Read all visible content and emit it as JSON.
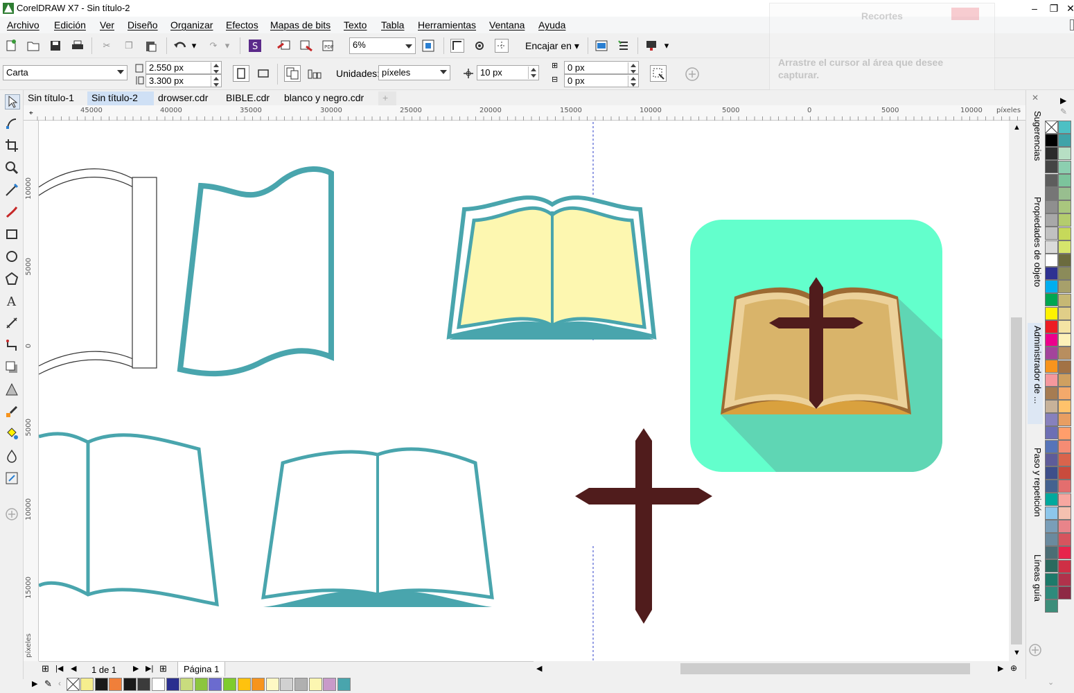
{
  "window": {
    "title": "CorelDRAW X7 - Sin título-2"
  },
  "menu": [
    "Archivo",
    "Edición",
    "Ver",
    "Diseño",
    "Organizar",
    "Efectos",
    "Mapas de bits",
    "Texto",
    "Tabla",
    "Herramientas",
    "Ventana",
    "Ayuda"
  ],
  "toolbar": {
    "zoom": "6%",
    "snap": "Encajar en"
  },
  "propertybar": {
    "paper": "Carta",
    "width": "2.550 px",
    "height": "3.300 px",
    "units_label": "Unidades:",
    "units": "píxeles",
    "nudge": "10 px",
    "dup_x": "0 px",
    "dup_y": "0 px"
  },
  "tabs": [
    "Sin título-1",
    "Sin título-2",
    "drowser.cdr",
    "BIBLE.cdr",
    "blanco y negro.cdr"
  ],
  "active_tab": "Sin título-2",
  "hruler": [
    "45000",
    "40000",
    "35000",
    "30000",
    "25000",
    "20000",
    "15000",
    "10000",
    "5000",
    "0",
    "5000",
    "10000",
    "píxeles"
  ],
  "vruler": [
    "10000",
    "5000",
    "0",
    "5000",
    "10000",
    "15000",
    "píxeles"
  ],
  "pagebar": {
    "count": "1 de 1",
    "page": "Página 1"
  },
  "dockers": [
    "Sugerencias",
    "Propiedades de objeto",
    "Administrador de ...",
    "Paso y repetición",
    "Líneas guía"
  ],
  "overlay": {
    "title": "Recortes",
    "text": "Arrastre el cursor al área que desee capturar."
  },
  "colors": {
    "teal": "#49a5ad",
    "cream": "#fdf7b0",
    "mint": "#63ffcc",
    "shadow": "#5fd6b4",
    "tan": "#d9b46a",
    "tanlight": "#ecd19a",
    "brown": "#9c6a33",
    "cross": "#501c1c",
    "gold": "#d9a13e"
  },
  "doc_palette": [
    "#f6ee8e",
    "#1a1a1a",
    "#f07f3a",
    "#1a1a1a",
    "#3b3b3b",
    "#ffffff",
    "#2a2f8f",
    "#c9dc7e",
    "#8cc63e",
    "#6b6bcf",
    "#7fcc2e",
    "#ffc20e",
    "#f7941d",
    "#fff8c4",
    "#d1d1d1",
    "#b0b0b0",
    "#fcf6b1",
    "#c89ac9",
    "#49a5ad"
  ],
  "palette_left": [
    "#000000",
    "#2b2b2b",
    "#444444",
    "#5d5d5d",
    "#767676",
    "#8f8f8f",
    "#a8a8a8",
    "#c1c1c1",
    "#dadada",
    "#ffffff",
    "#2e3192",
    "#00aeef",
    "#00a651",
    "#fff200",
    "#ed1c24",
    "#ec008c",
    "#a3449b",
    "#f7941d",
    "#f5989d",
    "#a67c52",
    "#c7b299",
    "#8781bd",
    "#6d6fb4",
    "#5674b9",
    "#5e5c99",
    "#3e4f8a",
    "#44628f",
    "#00a99d",
    "#8dc6ea",
    "#7a9eb8",
    "#6b8a9e",
    "#4b6d74",
    "#2a6a5e",
    "#1d7a6a",
    "#2e8a7c",
    "#3d8e7a"
  ],
  "palette_right": [
    "#4dc0c4",
    "#3fa3a8",
    "#b7dfc4",
    "#8ccfb0",
    "#7cc49c",
    "#98be8f",
    "#a9c67e",
    "#b4cc6e",
    "#c6d95a",
    "#d6e56c",
    "#6b6b3e",
    "#8b8b5a",
    "#a7a06b",
    "#c6b874",
    "#e0ce88",
    "#f4e4a4",
    "#fdf1b8",
    "#b88e5f",
    "#a27245",
    "#cfa060",
    "#f3a96b",
    "#ffc26b",
    "#e89e62",
    "#ff9e6b",
    "#f48c74",
    "#d9644c",
    "#c94b3d",
    "#e36e6e",
    "#f7a7a0",
    "#f4c1b0",
    "#e8848a",
    "#d6545e",
    "#e7244c",
    "#cf2f45",
    "#b0324b",
    "#8e2a45"
  ]
}
